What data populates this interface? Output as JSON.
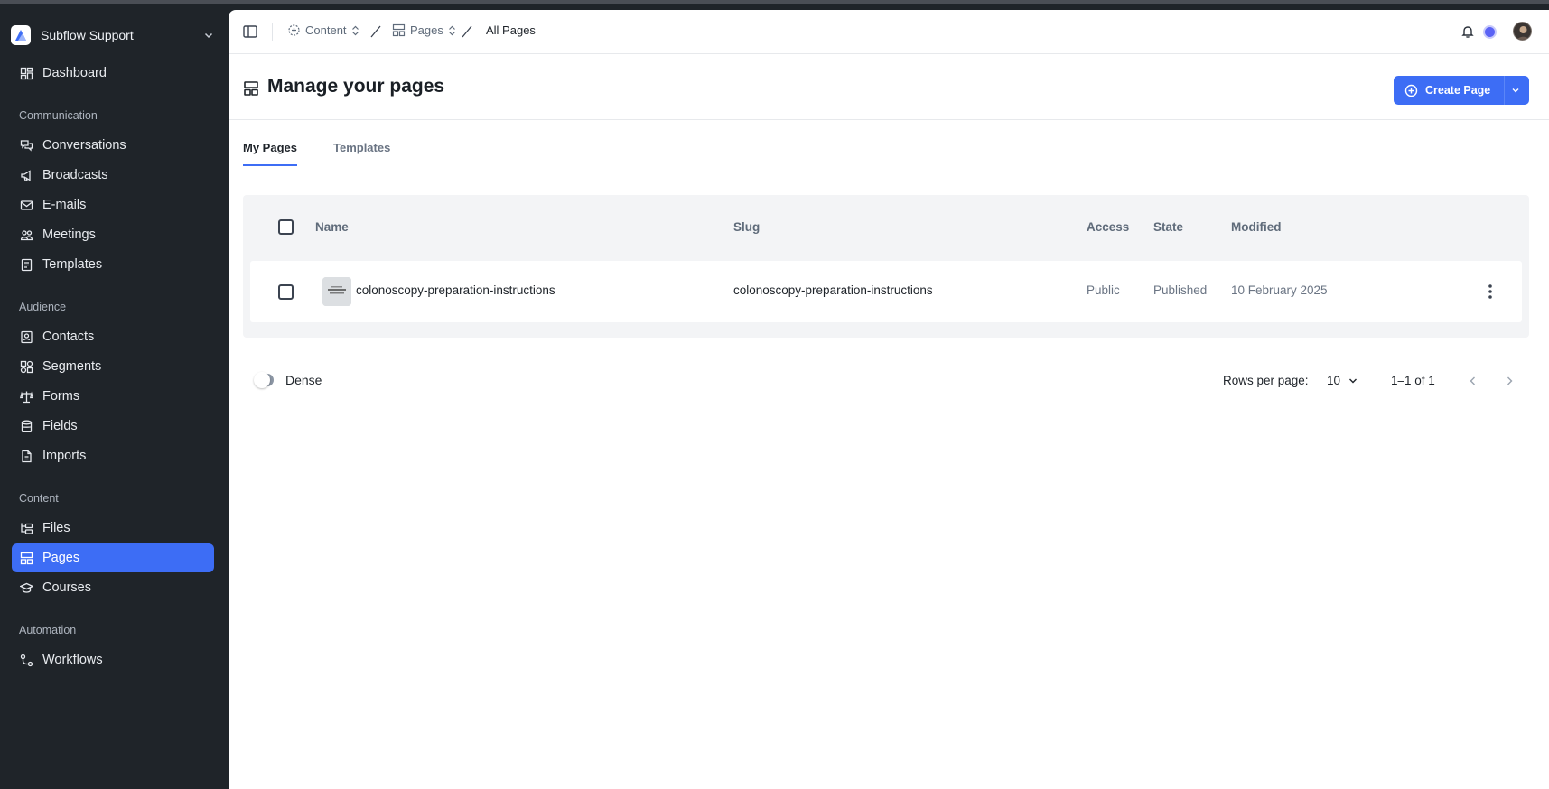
{
  "workspace": {
    "name": "Subflow Support"
  },
  "sidebar": {
    "dashboard": "Dashboard",
    "sections": {
      "communication": "Communication",
      "audience": "Audience",
      "content": "Content",
      "automation": "Automation"
    },
    "items": {
      "conversations": "Conversations",
      "broadcasts": "Broadcasts",
      "emails": "E-mails",
      "meetings": "Meetings",
      "templates": "Templates",
      "contacts": "Contacts",
      "segments": "Segments",
      "forms": "Forms",
      "fields": "Fields",
      "imports": "Imports",
      "files": "Files",
      "pages": "Pages",
      "courses": "Courses",
      "workflows": "Workflows"
    },
    "active": "pages"
  },
  "breadcrumb": {
    "content": "Content",
    "pages": "Pages",
    "current": "All Pages"
  },
  "header": {
    "title": "Manage your pages",
    "create_button": "Create Page"
  },
  "tabs": {
    "my_pages": "My Pages",
    "templates": "Templates",
    "active": "my_pages"
  },
  "table": {
    "columns": {
      "name": "Name",
      "slug": "Slug",
      "access": "Access",
      "state": "State",
      "modified": "Modified"
    },
    "rows": [
      {
        "name": "colonoscopy-preparation-instructions",
        "slug": "colonoscopy-preparation-instructions",
        "access": "Public",
        "state": "Published",
        "modified": "10 February 2025"
      }
    ]
  },
  "footer": {
    "dense_label": "Dense",
    "dense_on": false,
    "rows_per_page_label": "Rows per page:",
    "rows_per_page_value": "10",
    "range": "1–1 of 1"
  },
  "colors": {
    "accent": "#3d6df5",
    "sidebar_bg": "#1f2429",
    "status_dot": "#5b63f5"
  }
}
